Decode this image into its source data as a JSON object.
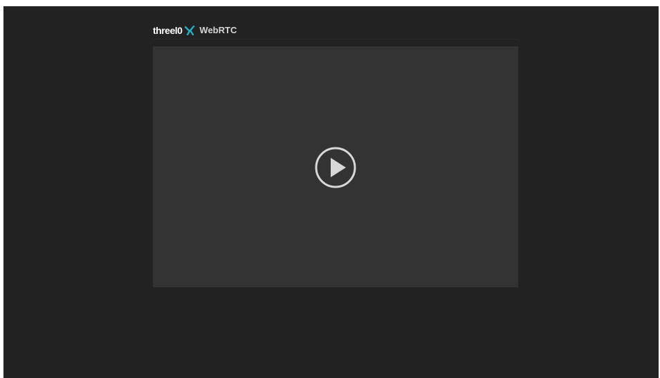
{
  "header": {
    "brand": "threel0",
    "product": "WebRTC",
    "logo_icon": "threel0-x-logo-icon"
  },
  "player": {
    "state": "paused",
    "play_icon": "play-circle-icon"
  },
  "colors": {
    "window_background": "#222222",
    "player_background": "#333333",
    "brand_text": "#ffffff",
    "product_text": "#d6d6d6",
    "logo_accent": "#23b3c9",
    "play_icon": "#d8d8d8"
  }
}
